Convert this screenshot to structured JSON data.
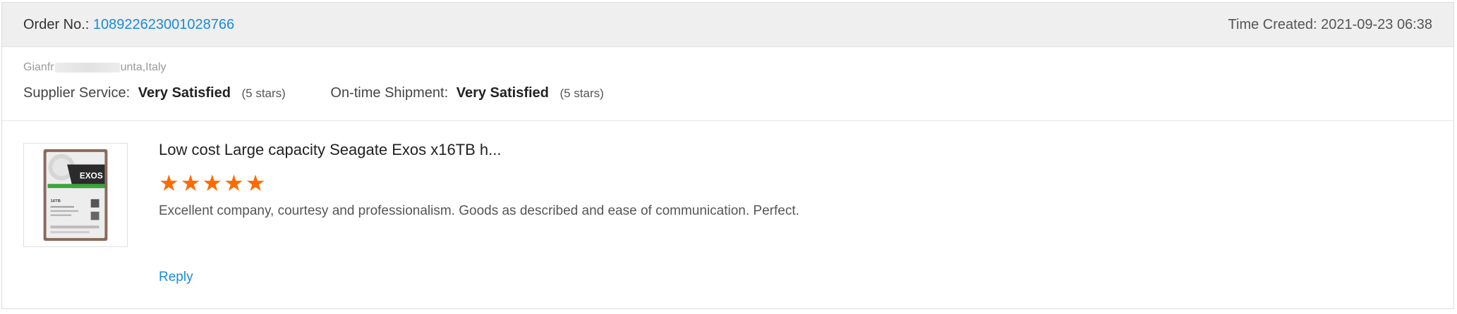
{
  "order": {
    "label": "Order No.:",
    "number": "108922623001028766",
    "time_label": "Time Created:",
    "time_value": "2021-09-23 06:38"
  },
  "buyer": {
    "name_start": "Gianfr",
    "name_end": "unta,Italy"
  },
  "ratings": {
    "supplier": {
      "label": "Supplier Service:",
      "value": "Very Satisfied",
      "stars_text": "(5 stars)"
    },
    "shipment": {
      "label": "On-time Shipment:",
      "value": "Very Satisfied",
      "stars_text": "(5 stars)"
    }
  },
  "review": {
    "product_title": "Low cost Large capacity Seagate Exos x16TB h...",
    "rating": 5,
    "max_rating": 5,
    "feedback": "Excellent company, courtesy and professionalism. Goods as described and ease of communication. Perfect.",
    "reply_label": "Reply",
    "thumbnail": {
      "brand_text": "EXOS",
      "capacity_text": "16TB"
    }
  },
  "colors": {
    "link": "#1a8bd6",
    "star": "#ff6a00",
    "header_bg": "#efefef"
  }
}
